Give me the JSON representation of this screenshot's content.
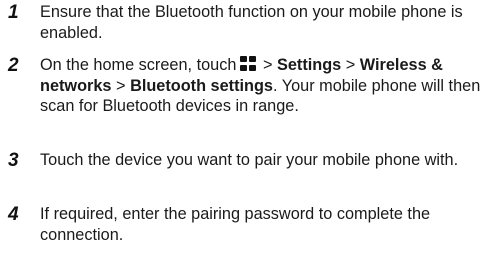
{
  "steps": [
    {
      "number": "1",
      "text": "Ensure that the Bluetooth function on your mobile phone is enabled."
    },
    {
      "number": "2",
      "part1": "On the home screen, touch",
      "icon": "app-grid-icon",
      "sep1": ">",
      "bold1": "Settings",
      "sep2": ">",
      "bold2": "Wireless & networks",
      "sep3": ">",
      "bold3": "Bluetooth settings",
      "part2": ". Your mobile phone will then scan for Bluetooth devices in range."
    },
    {
      "number": "3",
      "text": "Touch the device you want to pair your mobile phone with."
    },
    {
      "number": "4",
      "text": "If required, enter the pairing password to complete the connection."
    }
  ]
}
